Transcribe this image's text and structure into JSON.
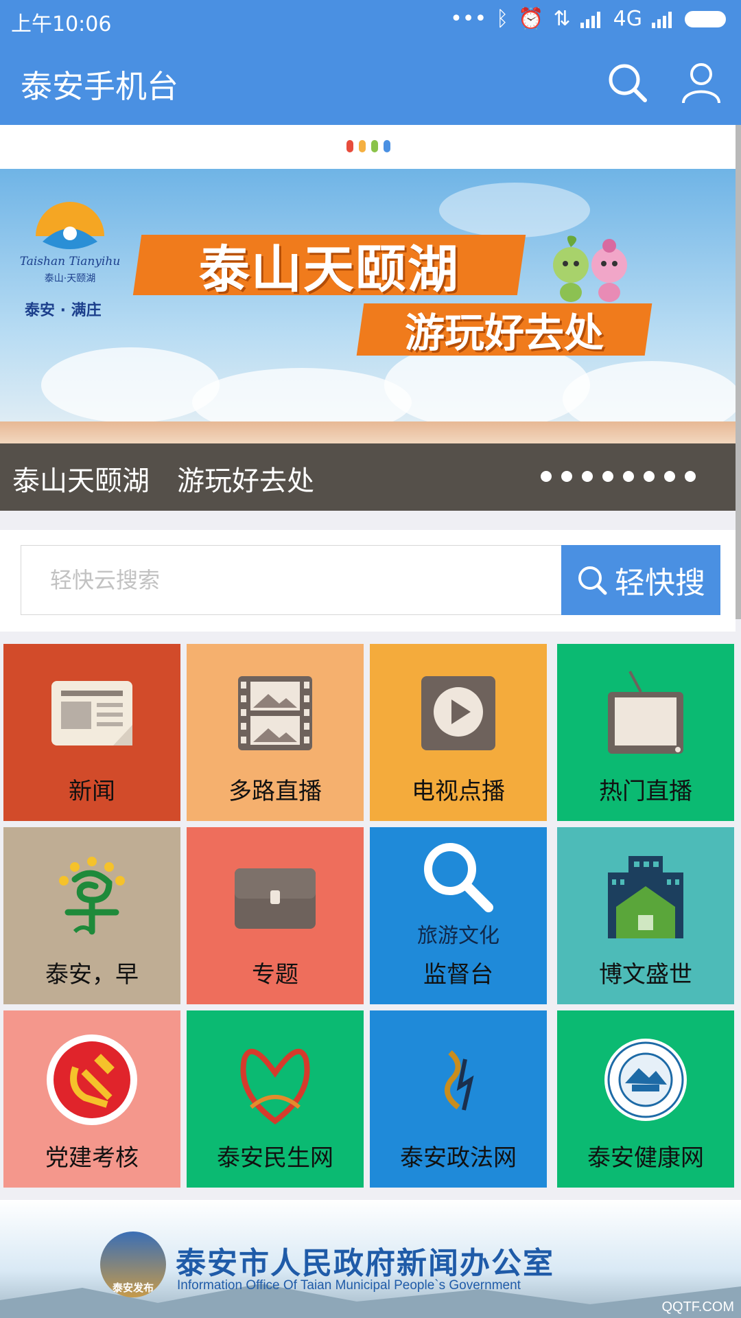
{
  "status_bar": {
    "time": "上午10:06",
    "network": "4G"
  },
  "app_bar": {
    "title": "泰安手机台"
  },
  "loader_colors": [
    "#e74c3c",
    "#f5b041",
    "#8bc34a",
    "#4a90e2"
  ],
  "banner": {
    "logo_brand": "Taishan Tianyihu",
    "logo_cn": "泰山·天颐湖",
    "logo_tag": "泰安 · 满庄",
    "headline": "泰山天颐湖",
    "subheadline": "游玩好去处",
    "caption": "泰山天颐湖　游玩好去处",
    "slide_count": 8,
    "active_slide": 1
  },
  "search": {
    "placeholder": "轻快云搜索",
    "button_label": "轻快搜"
  },
  "tiles": [
    {
      "label": "新闻",
      "color": "#d24b2a",
      "icon": "newspaper-icon"
    },
    {
      "label": "多路直播",
      "color": "#f5b06e",
      "icon": "film-icon"
    },
    {
      "label": "电视点播",
      "color": "#f4ab3c",
      "icon": "play-icon"
    },
    {
      "label": "热门直播",
      "color": "#0bba72",
      "icon": "tv-icon"
    },
    {
      "label": "泰安，早",
      "color": "#bfad94",
      "icon": "morning-logo-icon"
    },
    {
      "label": "专题",
      "color": "#ee6e5c",
      "icon": "briefcase-icon"
    },
    {
      "label": "监督台",
      "color": "#1f8ad9",
      "icon": "magnifier-icon",
      "sublabel": "旅游文化"
    },
    {
      "label": "博文盛世",
      "color": "#4dbbb8",
      "icon": "building-icon"
    },
    {
      "label": "党建考核",
      "color": "#f4978c",
      "icon": "party-emblem-icon"
    },
    {
      "label": "泰安民生网",
      "color": "#0bba72",
      "icon": "ribbon-logo-icon"
    },
    {
      "label": "泰安政法网",
      "color": "#1f8ad9",
      "icon": "law-logo-icon"
    },
    {
      "label": "泰安健康网",
      "color": "#0bba72",
      "icon": "health-seal-icon"
    }
  ],
  "footer": {
    "title": "泰安市人民政府新闻办公室",
    "subtitle": "Information Office Of Taian Municipal People`s Government",
    "seal_text": "泰安发布"
  },
  "watermark": "QQTF.COM"
}
